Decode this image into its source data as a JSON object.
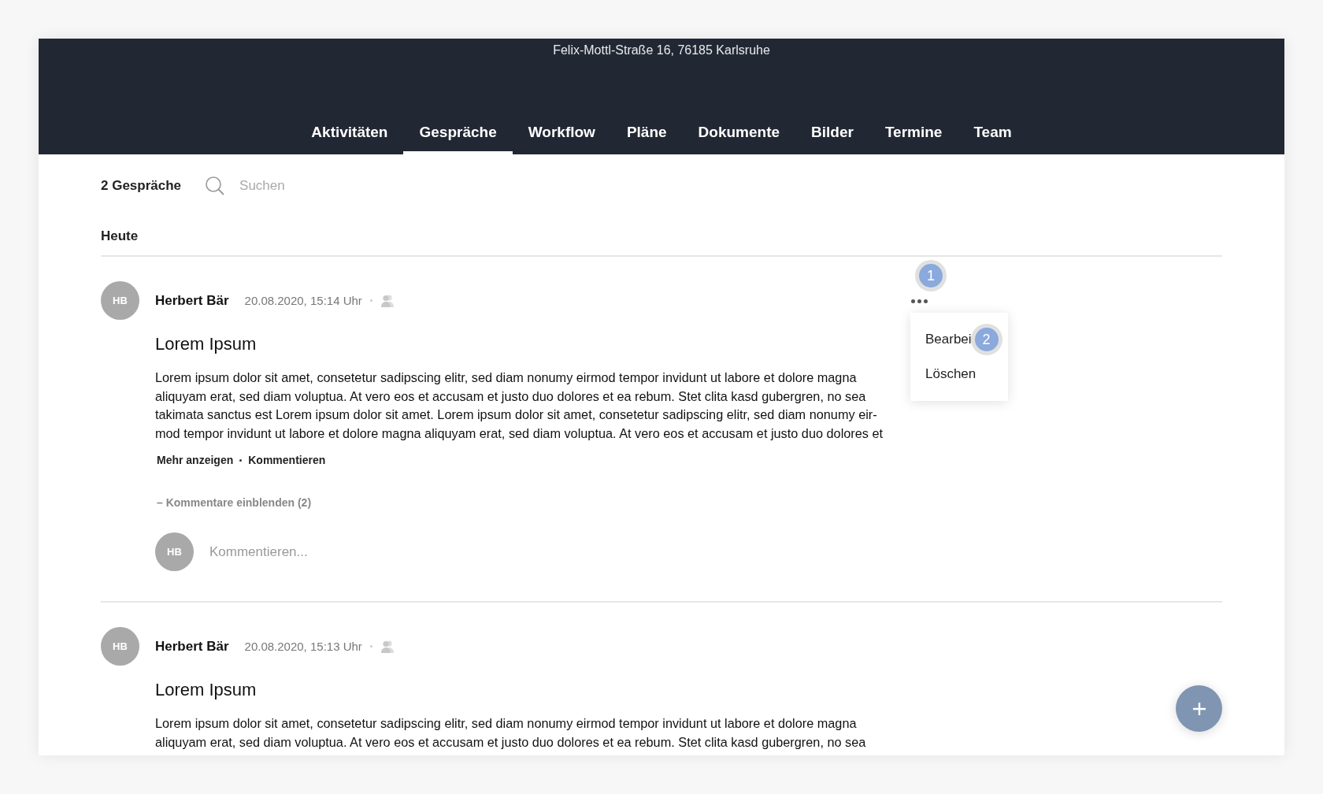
{
  "header": {
    "address": "Felix-Mottl-Straße 16, 76185 Karlsruhe"
  },
  "tabs": [
    {
      "label": "Aktivitäten",
      "selected": false
    },
    {
      "label": "Gespräche",
      "selected": true
    },
    {
      "label": "Workflow",
      "selected": false
    },
    {
      "label": "Pläne",
      "selected": false
    },
    {
      "label": "Dokumente",
      "selected": false
    },
    {
      "label": "Bilder",
      "selected": false
    },
    {
      "label": "Termine",
      "selected": false
    },
    {
      "label": "Team",
      "selected": false
    }
  ],
  "toolbar": {
    "count": "2 Gespräche",
    "search": {
      "placeholder": "Suchen"
    }
  },
  "section": "Heute",
  "posts": [
    {
      "initials": "HB",
      "author": "Herbert Bär",
      "timestamp": "20.08.2020, 15:14 Uhr",
      "title": "Lorem Ipsum",
      "body_lines": [
        "Lorem ipsum dolor sit amet, consetetur sadipscing elitr, sed diam nonumy eirmod tempor invidunt ut labore et dolore magna",
        "aliquyam erat, sed diam voluptua. At vero eos et accusam et justo duo dolores et ea rebum. Stet clita kasd gubergren, no sea",
        "takimata sanctus est Lorem ipsum dolor sit amet. Lorem ipsum dolor sit amet, consetetur sadipscing elitr, sed diam nonumy eir-",
        "mod tempor invidunt ut labore et dolore magna aliquyam erat, sed diam voluptua. At vero eos et accusam et justo duo dolores et"
      ],
      "actions": [
        "Mehr anzeigen",
        "Kommentieren"
      ],
      "comments_toggle": "– Kommentare einblenden (2)",
      "comment_field": {
        "initials": "HB",
        "placeholder": "Kommentieren..."
      },
      "menu": {
        "open": true,
        "marker": "1",
        "items": [
          {
            "label": "Bearbei",
            "marker": "2"
          },
          {
            "label": "Löschen"
          }
        ]
      }
    },
    {
      "initials": "HB",
      "author": "Herbert Bär",
      "timestamp": "20.08.2020, 15:13 Uhr",
      "title": "Lorem Ipsum",
      "body_lines": [
        "Lorem ipsum dolor sit amet, consetetur sadipscing elitr, sed diam nonumy eirmod tempor invidunt ut labore et dolore magna",
        "aliquyam erat, sed diam voluptua. At vero eos et accusam et justo duo dolores et ea rebum. Stet clita kasd gubergren, no sea"
      ]
    }
  ]
}
